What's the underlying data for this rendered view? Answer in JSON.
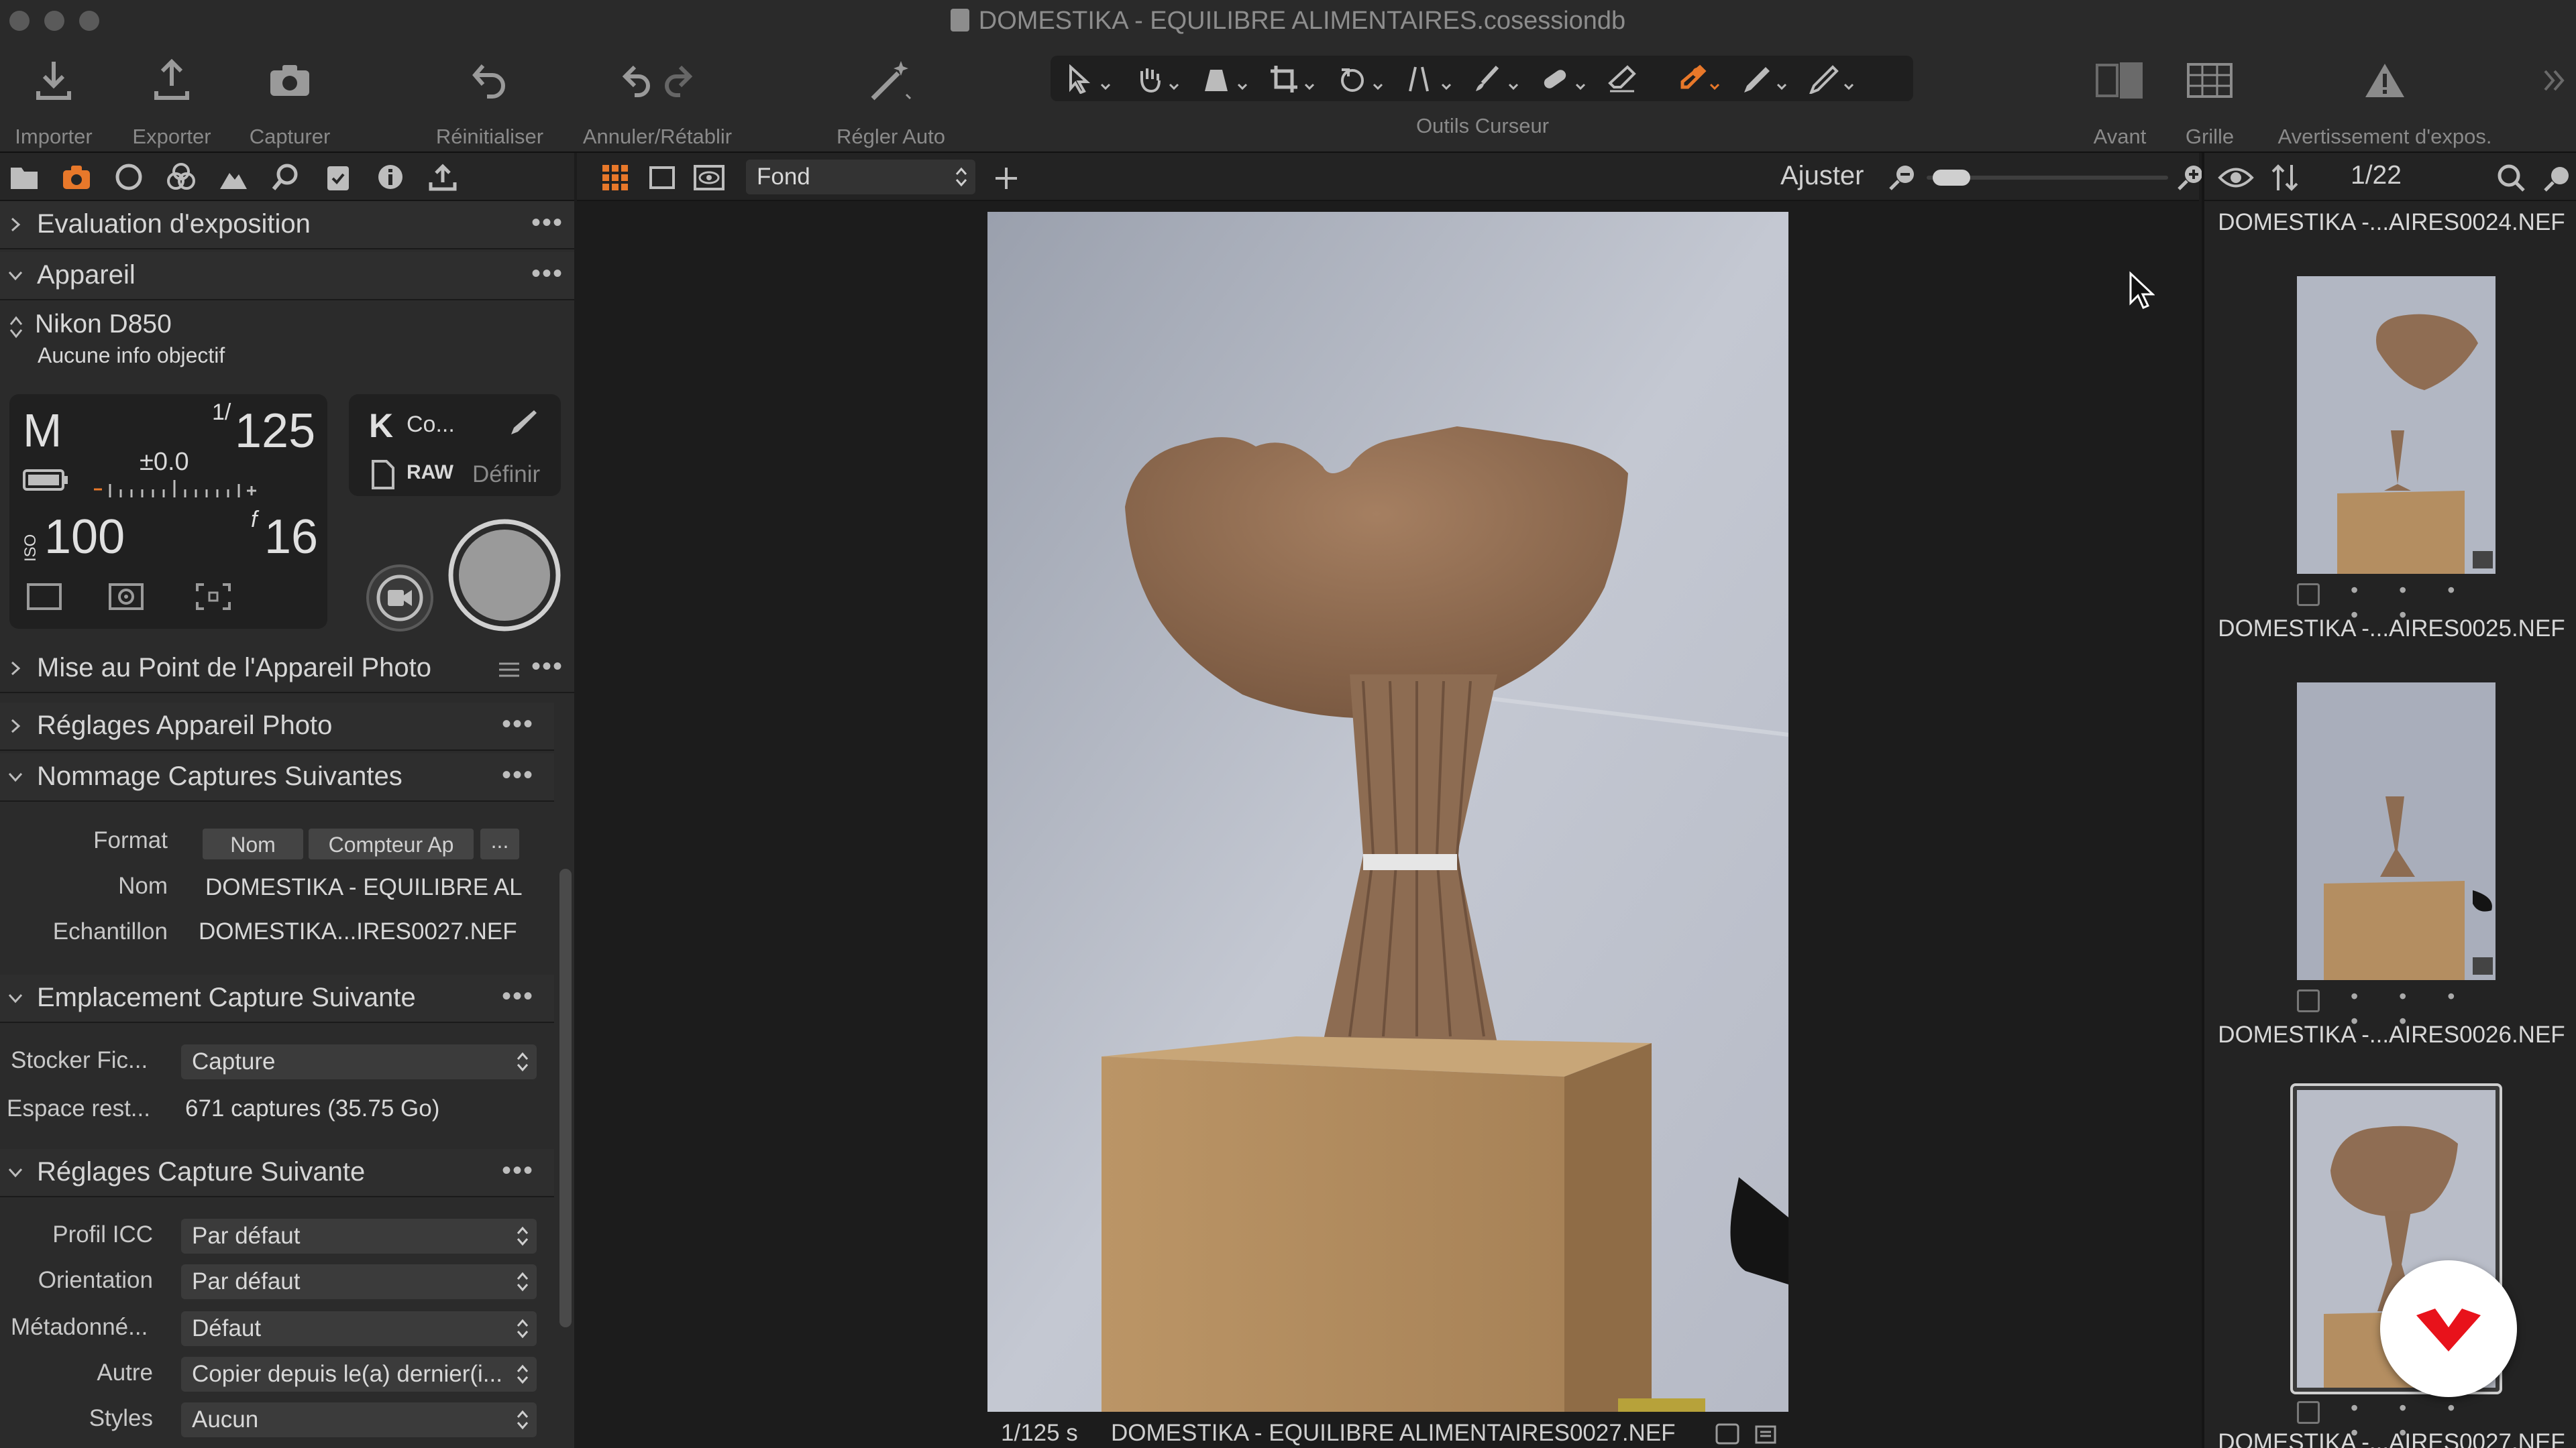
{
  "window": {
    "title": "DOMESTIKA - EQUILIBRE ALIMENTAIRES.cosessiondb"
  },
  "toolbar": {
    "import_label": "Importer",
    "export_label": "Exporter",
    "capture_label": "Capturer",
    "reset_label": "Réinitialiser",
    "undo_redo_label": "Annuler/Rétablir",
    "auto_adjust_label": "Régler Auto",
    "cursor_tools_label": "Outils Curseur",
    "before_label": "Avant",
    "grid_label": "Grille",
    "exposure_warning_label": "Avertissement d'expos.",
    "active_tool_color": "#e8782a"
  },
  "left_panel": {
    "exposure_eval_title": "Evaluation d'exposition",
    "camera_title": "Appareil",
    "camera_model": "Nikon D850",
    "lens_info": "Aucune info objectif",
    "mode": "M",
    "shutter_num": "1/",
    "shutter_den": "125",
    "exposure_comp": "±0.0",
    "iso_label": "ISO",
    "iso_value": "100",
    "aperture_prefix": "f",
    "aperture_value": "16",
    "wb_label": "K",
    "wb_value": "Co...",
    "file_format": "RAW",
    "define_label": "Définir",
    "focus_title": "Mise au Point de l'Appareil Photo",
    "camera_settings_title": "Réglages Appareil Photo",
    "naming_title": "Nommage Captures Suivantes",
    "format_label": "Format",
    "format_token_1": "Nom",
    "format_token_2": "Compteur Ap",
    "format_more": "...",
    "name_label": "Nom",
    "name_value": "DOMESTIKA - EQUILIBRE AL",
    "sample_label": "Echantillon",
    "sample_value": "DOMESTIKA...IRES0027.NEF",
    "location_title": "Emplacement Capture Suivante",
    "store_label": "Stocker Fic...",
    "store_value": "Capture",
    "space_label": "Espace rest...",
    "space_value": "671 captures (35.75 Go)",
    "next_settings_title": "Réglages Capture Suivante",
    "icc_label": "Profil ICC",
    "icc_value": "Par défaut",
    "orientation_label": "Orientation",
    "orientation_value": "Par défaut",
    "metadata_label": "Métadonné...",
    "metadata_value": "Défaut",
    "other_label": "Autre",
    "other_value": "Copier depuis le(a) dernier(i...",
    "styles_label": "Styles",
    "styles_value": "Aucun",
    "tab_active_color": "#e8782a"
  },
  "viewer": {
    "background_select": "Fond",
    "fit_label": "Ajuster",
    "zoom_level": 0.03,
    "status_shutter": "1/125 s",
    "status_filename": "DOMESTIKA - EQUILIBRE ALIMENTAIRES0027.NEF"
  },
  "browser": {
    "counter": "1/22",
    "top_filename": "DOMESTIKA -...AIRES0024.NEF",
    "thumbnails": [
      {
        "name": "DOMESTIKA -...AIRES0025.NEF"
      },
      {
        "name": "DOMESTIKA -...AIRES0026.NEF"
      },
      {
        "name": "DOMESTIKA -...AIRES0027.NEF"
      }
    ],
    "rating_dots": "• • • • •"
  },
  "brand": {
    "logo_color": "#e8121b"
  }
}
